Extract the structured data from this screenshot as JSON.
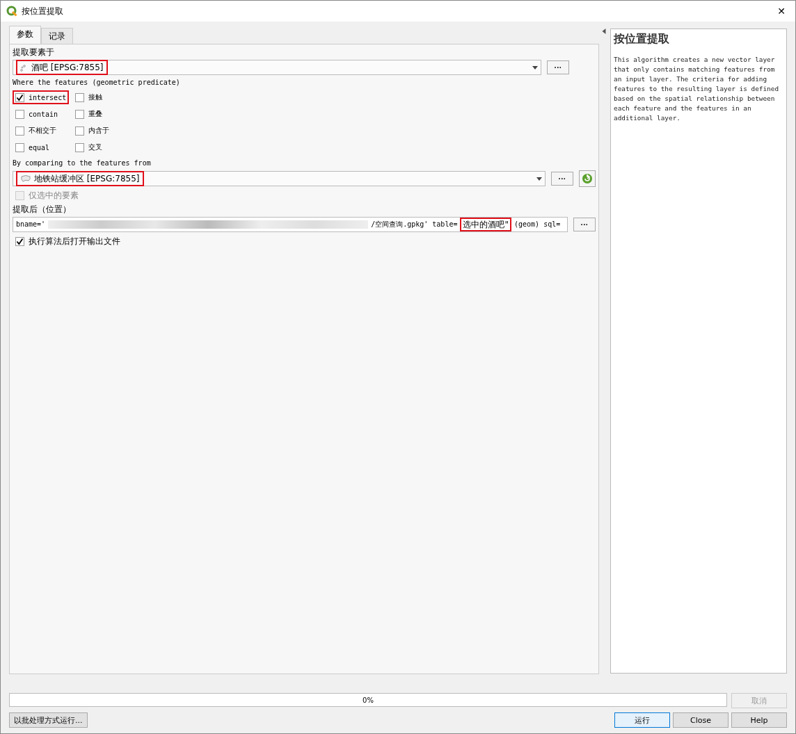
{
  "window": {
    "title": "按位置提取",
    "close": "✕"
  },
  "tabs": [
    {
      "label": "参数",
      "selected": true
    },
    {
      "label": "记录",
      "selected": false
    }
  ],
  "input_layer": {
    "label": "提取要素于",
    "value": "酒吧 [EPSG:7855]",
    "highlighted": true,
    "browse": "···"
  },
  "predicate": {
    "label": "Where the features (geometric predicate)",
    "options": [
      {
        "label": "intersect",
        "checked": true,
        "highlighted": true
      },
      {
        "label": "接触",
        "checked": false,
        "highlighted": false
      },
      {
        "label": "contain",
        "checked": false,
        "highlighted": false
      },
      {
        "label": "重叠",
        "checked": false,
        "highlighted": false
      },
      {
        "label": "不相交于",
        "checked": false,
        "highlighted": false
      },
      {
        "label": "内含于",
        "checked": false,
        "highlighted": false
      },
      {
        "label": "equal",
        "checked": false,
        "highlighted": false
      },
      {
        "label": "交叉",
        "checked": false,
        "highlighted": false
      }
    ]
  },
  "compare_layer": {
    "label": "By comparing to the features from",
    "value": "地铁站缓冲区 [EPSG:7855]",
    "highlighted": true,
    "browse": "···"
  },
  "selected_only": {
    "label": "仅选中的要素",
    "checked": false,
    "disabled": true
  },
  "output": {
    "label": "提取后（位置）",
    "parts": [
      {
        "text": "bname='",
        "highlighted": false
      },
      {
        "text": "/空间查询.gpkg' table=",
        "highlighted": false
      },
      {
        "text": "选中的酒吧\"",
        "highlighted": true
      },
      {
        "text": " (geom) sql=",
        "highlighted": false
      }
    ],
    "browse": "···"
  },
  "open_output": {
    "label": "执行算法后打开输出文件",
    "checked": true
  },
  "help": {
    "title": "按位置提取",
    "text": "This algorithm creates a new vector layer that only contains matching features from an input layer. The criteria for adding features to the resulting layer is defined based on the spatial relationship between each feature and the features in an additional layer."
  },
  "progress": {
    "level": 0,
    "reading": "0%"
  },
  "buttons": [
    {
      "label": "取消",
      "disabled": true
    },
    {
      "label": "以批处理方式运行...",
      "disabled": false
    },
    {
      "label": "运行",
      "disabled": false,
      "default": true
    },
    {
      "label": "Close",
      "disabled": false
    },
    {
      "label": "Help",
      "disabled": false
    }
  ]
}
